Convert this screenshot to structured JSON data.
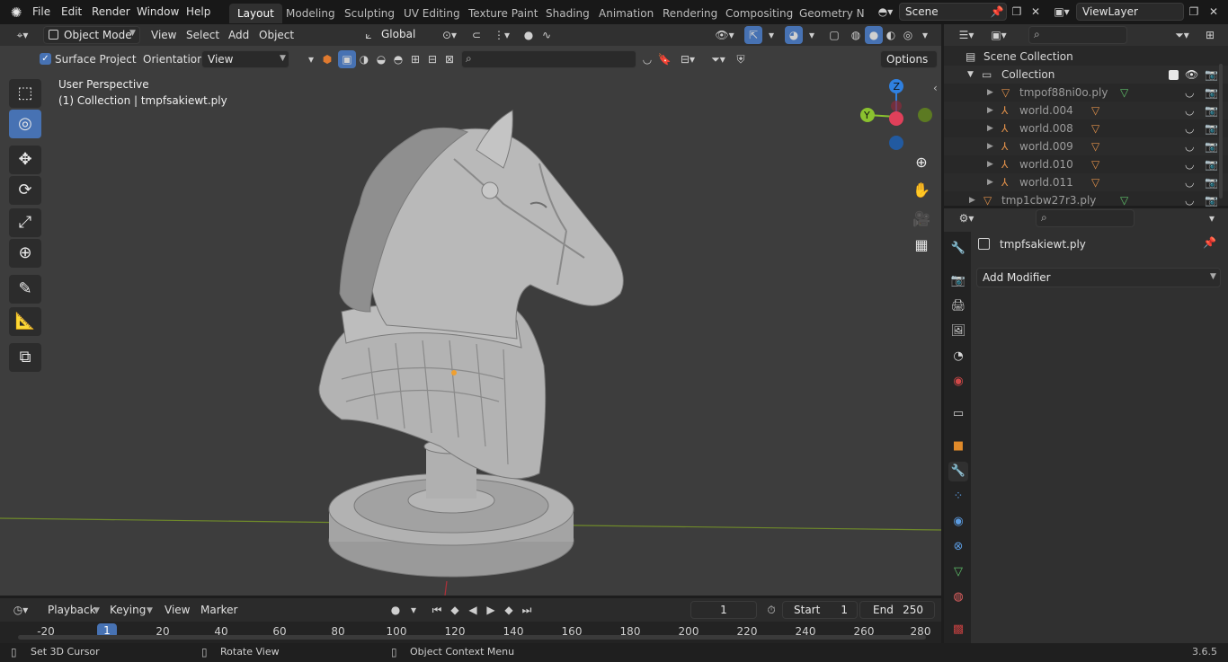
{
  "topbar": {
    "menus": [
      "File",
      "Edit",
      "Render",
      "Window",
      "Help"
    ],
    "workspaces": [
      "Layout",
      "Modeling",
      "Sculpting",
      "UV Editing",
      "Texture Paint",
      "Shading",
      "Animation",
      "Rendering",
      "Compositing",
      "Geometry Noc"
    ],
    "active_workspace": "Layout",
    "scene": "Scene",
    "view_layer": "ViewLayer"
  },
  "viewport_header": {
    "mode": "Object Mode",
    "menus": [
      "View",
      "Select",
      "Add",
      "Object"
    ],
    "transform_orientation": "Global",
    "surface_project_label": "Surface Project",
    "orientation_label": "Orientation:",
    "orientation_value": "View",
    "options_label": "Options"
  },
  "viewport": {
    "perspective_label": "User Perspective",
    "object_label": "(1) Collection | tmpfsakiewt.ply",
    "gizmo_axes": [
      "X",
      "Y",
      "Z"
    ],
    "colors": {
      "x_axis": "#e0405a",
      "y_axis": "#8ac12f",
      "z_axis": "#2f80e0",
      "background": "#3d3d3d"
    }
  },
  "outliner": {
    "root": "Scene Collection",
    "collection": "Collection",
    "items": [
      {
        "name": "tmpof88ni0o.ply",
        "type": "mesh"
      },
      {
        "name": "world.004",
        "type": "empty"
      },
      {
        "name": "world.008",
        "type": "empty"
      },
      {
        "name": "world.009",
        "type": "empty"
      },
      {
        "name": "world.010",
        "type": "empty"
      },
      {
        "name": "world.011",
        "type": "empty"
      },
      {
        "name": "tmp1cbw27r3.ply",
        "type": "mesh"
      }
    ]
  },
  "properties": {
    "object_name": "tmpfsakiewt.ply",
    "add_modifier_label": "Add Modifier"
  },
  "timeline": {
    "menus": [
      "Playback",
      "Keying",
      "View",
      "Marker"
    ],
    "current_frame": "1",
    "start_label": "Start",
    "start_value": "1",
    "end_label": "End",
    "end_value": "250",
    "ruler_ticks": [
      "-20",
      "1",
      "20",
      "40",
      "60",
      "80",
      "100",
      "120",
      "140",
      "160",
      "180",
      "200",
      "220",
      "240",
      "260",
      "280"
    ]
  },
  "statusbar": {
    "hint1": "Set 3D Cursor",
    "hint2": "Rotate View",
    "hint3": "Object Context Menu",
    "version": "3.6.5"
  }
}
